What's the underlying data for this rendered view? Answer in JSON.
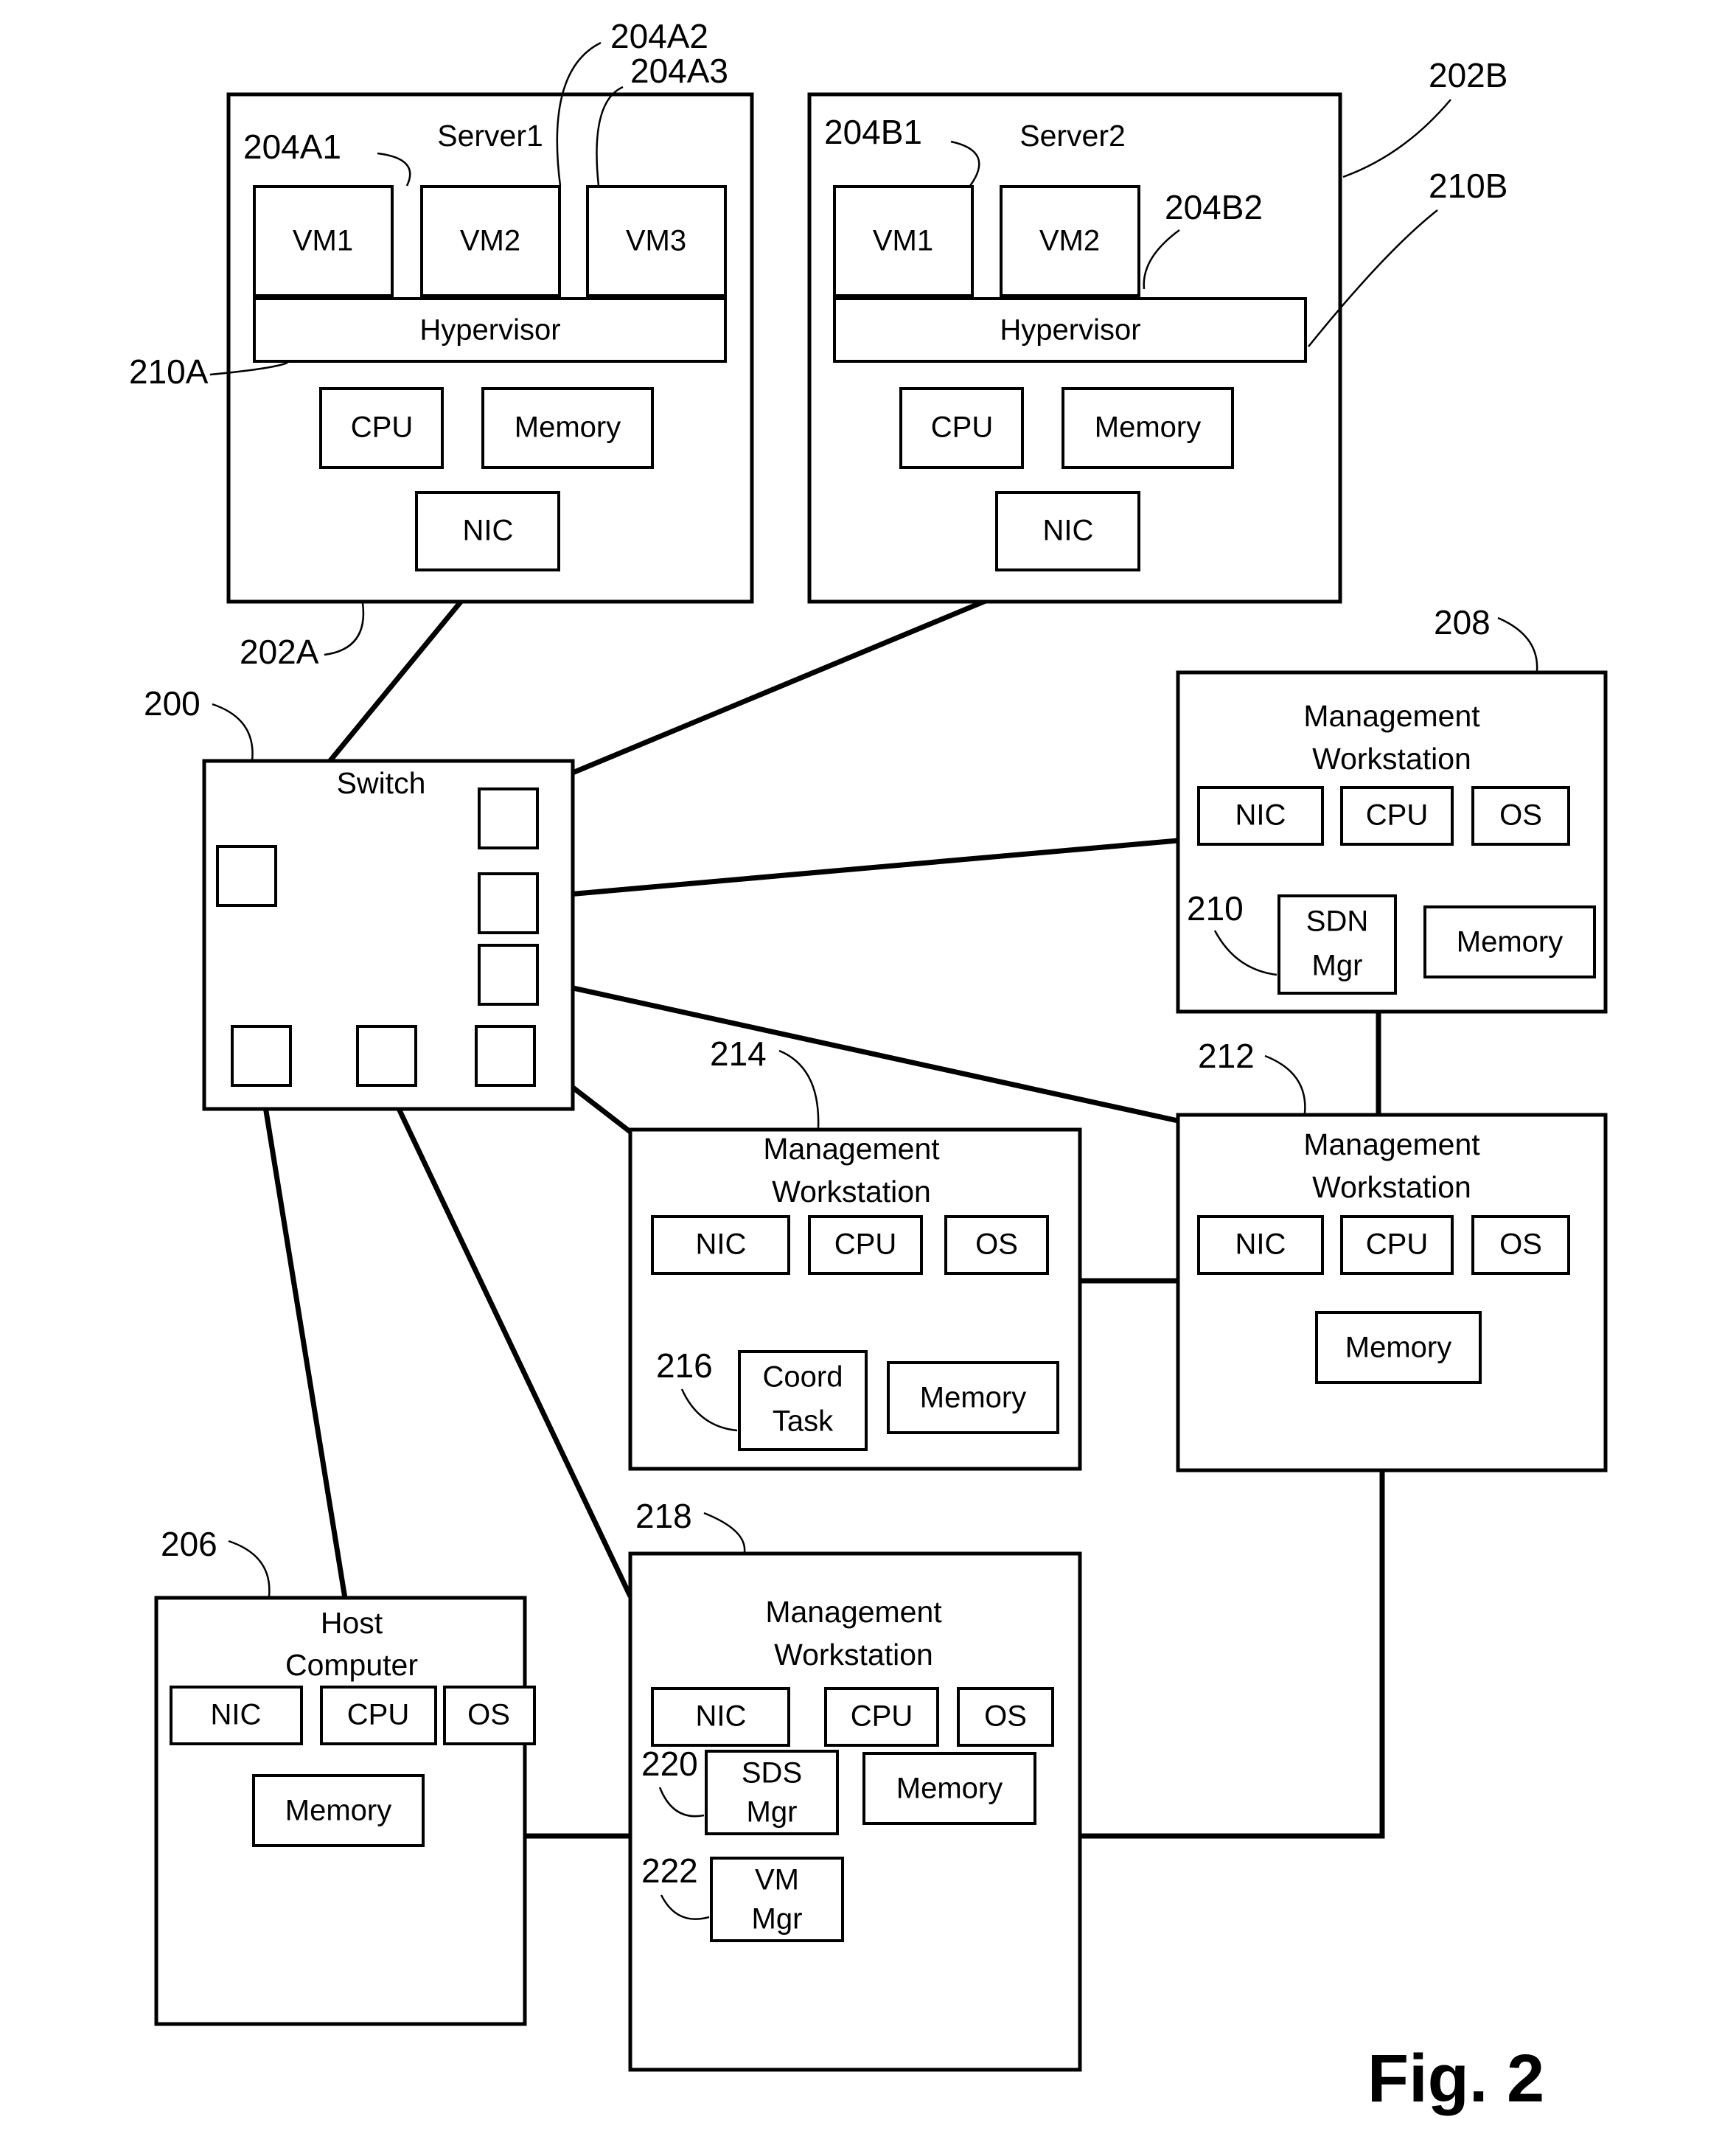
{
  "figure": {
    "label": "Fig. 2",
    "title_text": "Fig. 2"
  },
  "nodes": {
    "server1": {
      "title": "Server1",
      "ref": "202A",
      "vms": [
        {
          "label": "VM1",
          "ref": "204A1"
        },
        {
          "label": "VM2",
          "ref": "204A2"
        },
        {
          "label": "VM3",
          "ref": "204A3"
        }
      ],
      "hypervisor": {
        "label": "Hypervisor",
        "ref": "210A"
      },
      "cpu": "CPU",
      "memory": "Memory",
      "nic": "NIC"
    },
    "server2": {
      "title": "Server2",
      "ref": "202B",
      "vms": [
        {
          "label": "VM1",
          "ref": "204B1"
        },
        {
          "label": "VM2",
          "ref": "204B2"
        }
      ],
      "hypervisor": {
        "label": "Hypervisor",
        "ref": "210B"
      },
      "cpu": "CPU",
      "memory": "Memory",
      "nic": "NIC"
    },
    "switch": {
      "title": "Switch",
      "ref": "200",
      "port_count": 7
    },
    "mgmt_workstation_208": {
      "title_line1": "Management",
      "title_line2": "Workstation",
      "ref": "208",
      "nic": "NIC",
      "cpu": "CPU",
      "os": "OS",
      "memory": "Memory",
      "module": {
        "line1": "SDN",
        "line2": "Mgr",
        "ref": "210"
      }
    },
    "mgmt_workstation_214": {
      "title_line1": "Management",
      "title_line2": "Workstation",
      "ref": "214",
      "nic": "NIC",
      "cpu": "CPU",
      "os": "OS",
      "memory": "Memory",
      "module": {
        "line1": "Coord",
        "line2": "Task",
        "ref": "216"
      }
    },
    "mgmt_workstation_212": {
      "title_line1": "Management",
      "title_line2": "Workstation",
      "ref": "212",
      "nic": "NIC",
      "cpu": "CPU",
      "os": "OS",
      "memory": "Memory"
    },
    "host_computer_206": {
      "title_line1": "Host",
      "title_line2": "Computer",
      "ref": "206",
      "nic": "NIC",
      "cpu": "CPU",
      "os": "OS",
      "memory": "Memory"
    },
    "mgmt_workstation_218": {
      "title_line1": "Management",
      "title_line2": "Workstation",
      "ref": "218",
      "nic": "NIC",
      "cpu": "CPU",
      "os": "OS",
      "memory": "Memory",
      "module_sds": {
        "line1": "SDS",
        "line2": "Mgr",
        "ref": "220"
      },
      "module_vm": {
        "line1": "VM",
        "line2": "Mgr",
        "ref": "222"
      }
    }
  },
  "colors": {
    "stroke": "#000000",
    "fill": "#ffffff"
  }
}
